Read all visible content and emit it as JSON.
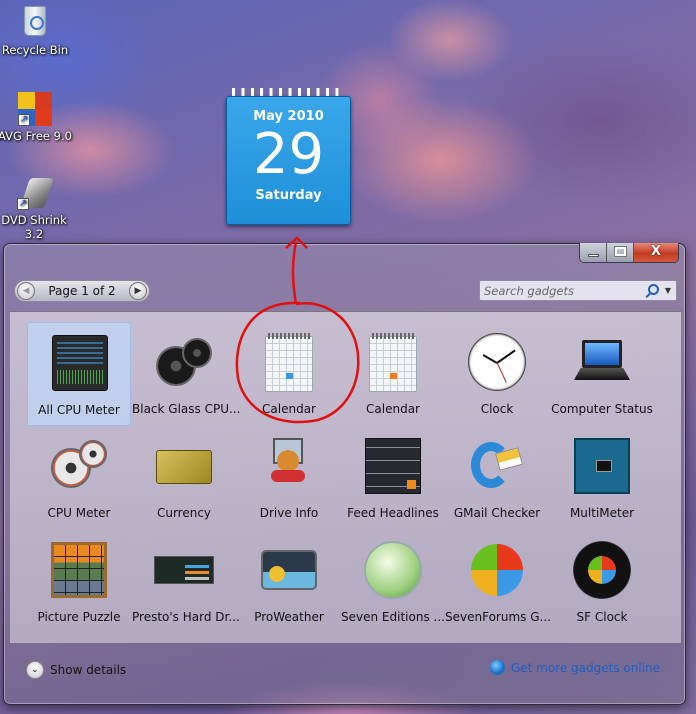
{
  "desktop": {
    "icons": [
      {
        "label": "Recycle Bin",
        "icon": "recycle-bin-icon"
      },
      {
        "label": "AVG Free 9.0",
        "icon": "avg-icon"
      },
      {
        "label": "DVD Shrink 3.2",
        "icon": "dvd-shrink-icon"
      }
    ]
  },
  "calendar_gadget": {
    "month_year": "May 2010",
    "day": "29",
    "weekday": "Saturday",
    "color": "#2a9be2"
  },
  "gadget_window": {
    "controls": {
      "minimize": "minimize",
      "maximize": "maximize",
      "close": "X"
    },
    "pager": {
      "text": "Page 1 of 2",
      "prev_icon": "◀",
      "next_icon": "▶"
    },
    "search": {
      "placeholder": "Search gadgets",
      "dropdown_icon": "▼"
    },
    "gadgets": [
      {
        "label": "All CPU Meter",
        "selected": true
      },
      {
        "label": "Black Glass CPU..."
      },
      {
        "label": "Calendar",
        "circled": true
      },
      {
        "label": "Calendar"
      },
      {
        "label": "Clock"
      },
      {
        "label": "Computer Status"
      },
      {
        "label": "CPU Meter"
      },
      {
        "label": "Currency"
      },
      {
        "label": "Drive Info"
      },
      {
        "label": "Feed Headlines"
      },
      {
        "label": "GMail Checker"
      },
      {
        "label": "MultiMeter"
      },
      {
        "label": "Picture Puzzle"
      },
      {
        "label": "Presto's Hard Dr..."
      },
      {
        "label": "ProWeather"
      },
      {
        "label": "Seven Editions ..."
      },
      {
        "label": "SevenForums G..."
      },
      {
        "label": "SF Clock"
      }
    ],
    "footer": {
      "show_details": "Show details",
      "chevron_icon": "⌄",
      "get_more": "Get more gadgets online",
      "link_color": "#1f5fc0"
    }
  },
  "annotation": {
    "color": "#e01010"
  }
}
